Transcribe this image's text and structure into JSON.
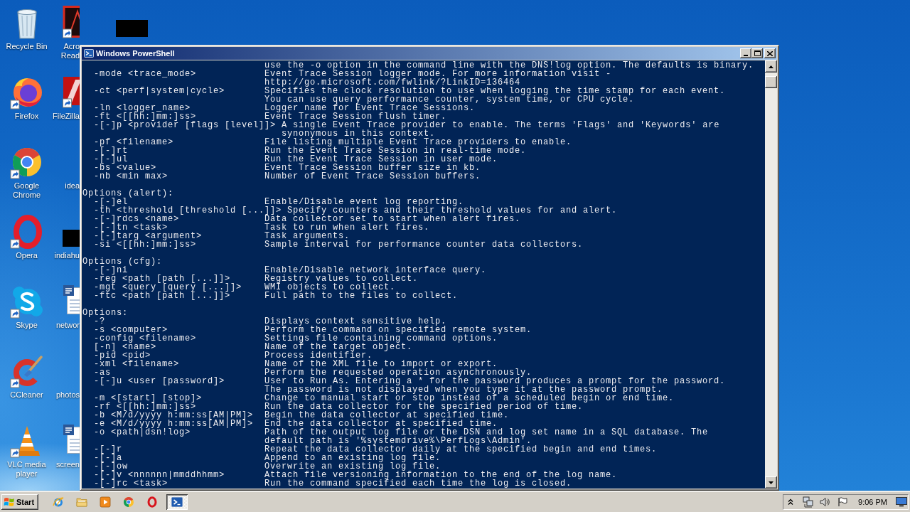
{
  "desktop": {
    "columns": [
      {
        "icons": [
          {
            "label": "Recycle Bin"
          },
          {
            "label": "Firefox"
          },
          {
            "label": "Google Chrome"
          },
          {
            "label": "Opera"
          },
          {
            "label": "Skype"
          },
          {
            "label": "CCleaner"
          },
          {
            "label": "VLC media player"
          }
        ]
      },
      {
        "icons": [
          {
            "label": "Acro Read"
          },
          {
            "label": "FileZilla"
          },
          {
            "label": "idea"
          },
          {
            "label": "indiahu"
          },
          {
            "label": "networ"
          },
          {
            "label": "photos"
          },
          {
            "label": "screen"
          }
        ]
      }
    ]
  },
  "window": {
    "title": "Windows PowerShell",
    "console": {
      "sections": [
        {
          "entries": [
            {
              "description": [
                "use the -o option in the command line with the DNS!log option. The defaults is binary."
              ]
            },
            {
              "option": "-mode <trace_mode>",
              "description": [
                "Event Trace Session logger mode. For more information visit -",
                "http://go.microsoft.com/fwlink/?LinkID=136464"
              ]
            },
            {
              "option": "-ct <perf|system|cycle>",
              "description": [
                "Specifies the clock resolution to use when logging the time stamp for each event.",
                "You can use query performance counter, system time, or CPU cycle."
              ]
            },
            {
              "option": "-ln <logger_name>",
              "description": [
                "Logger name for Event Trace Sessions."
              ]
            },
            {
              "option": "-ft <[[hh:]mm:]ss>",
              "description": [
                "Event Trace Session flush timer."
              ]
            },
            {
              "option": "-[-]p <provider [flags [level]]>",
              "description": [
                "A single Event Trace provider to enable. The terms 'Flags' and 'Keywords' are",
                "synonymous in this context."
              ]
            },
            {
              "option": "-pf <filename>",
              "description": [
                "File listing multiple Event Trace providers to enable."
              ]
            },
            {
              "option": "-[-]rt",
              "description": [
                "Run the Event Trace Session in real-time mode."
              ]
            },
            {
              "option": "-[-]ul",
              "description": [
                "Run the Event Trace Session in user mode."
              ]
            },
            {
              "option": "-bs <value>",
              "description": [
                "Event Trace Session buffer size in kb."
              ]
            },
            {
              "option": "-nb <min max>",
              "description": [
                "Number of Event Trace Session buffers."
              ]
            }
          ]
        },
        {
          "heading": "Options (alert):",
          "entries": [
            {
              "option": "-[-]el",
              "description": [
                "Enable/Disable event log reporting."
              ]
            },
            {
              "option": "-th <threshold [threshold [...]]>",
              "description": [
                "Specify counters and their threshold values for and alert."
              ]
            },
            {
              "option": "-[-]rdcs <name>",
              "description": [
                "Data collector set to start when alert fires."
              ]
            },
            {
              "option": "-[-]tn <task>",
              "description": [
                "Task to run when alert fires."
              ]
            },
            {
              "option": "-[-]targ <argument>",
              "description": [
                "Task arguments."
              ]
            },
            {
              "option": "-si <[[hh:]mm:]ss>",
              "description": [
                "Sample interval for performance counter data collectors."
              ]
            }
          ]
        },
        {
          "heading": "Options (cfg):",
          "entries": [
            {
              "option": "-[-]ni",
              "description": [
                "Enable/Disable network interface query."
              ]
            },
            {
              "option": "-reg <path [path [...]]>",
              "description": [
                "Registry values to collect."
              ]
            },
            {
              "option": "-mgt <query [query [...]]>",
              "description": [
                "WMI objects to collect."
              ]
            },
            {
              "option": "-ftc <path [path [...]]>",
              "description": [
                "Full path to the files to collect."
              ]
            }
          ]
        },
        {
          "heading": "Options:",
          "entries": [
            {
              "option": "-?",
              "description": [
                "Displays context sensitive help."
              ]
            },
            {
              "option": "-s <computer>",
              "description": [
                "Perform the command on specified remote system."
              ]
            },
            {
              "option": "-config <filename>",
              "description": [
                "Settings file containing command options."
              ]
            },
            {
              "option": "[-n] <name>",
              "description": [
                "Name of the target object."
              ]
            },
            {
              "option": "-pid <pid>",
              "description": [
                "Process identifier."
              ]
            },
            {
              "option": "-xml <filename>",
              "description": [
                "Name of the XML file to import or export."
              ]
            },
            {
              "option": "-as",
              "description": [
                "Perform the requested operation asynchronously."
              ]
            },
            {
              "option": "-[-]u <user [password]>",
              "description": [
                "User to Run As. Entering a * for the password produces a prompt for the password.",
                "The password is not displayed when you type it at the password prompt."
              ]
            },
            {
              "option": "-m <[start] [stop]>",
              "description": [
                "Change to manual start or stop instead of a scheduled begin or end time."
              ]
            },
            {
              "option": "-rf <[[hh:]mm:]ss>",
              "description": [
                "Run the data collector for the specified period of time."
              ]
            },
            {
              "option": "-b <M/d/yyyy h:mm:ss[AM|PM]>",
              "description": [
                "Begin the data collector at specified time."
              ]
            },
            {
              "option": "-e <M/d/yyyy h:mm:ss[AM|PM]>",
              "description": [
                "End the data collector at specified time."
              ]
            },
            {
              "option": "-o <path|dsn!log>",
              "description": [
                "Path of the output log file or the DSN and log set name in a SQL database. The",
                "default path is '%systemdrive%\\PerfLogs\\Admin'."
              ]
            },
            {
              "option": "-[-]r",
              "description": [
                "Repeat the data collector daily at the specified begin and end times."
              ]
            },
            {
              "option": "-[-]a",
              "description": [
                "Append to an existing log file."
              ]
            },
            {
              "option": "-[-]ow",
              "description": [
                "Overwrite an existing log file."
              ]
            },
            {
              "option": "-[-]v <nnnnnn|mmddhhmm>",
              "description": [
                "Attach file versioning information to the end of the log name."
              ]
            },
            {
              "option": "-[-]rc <task>",
              "description": [
                "Run the command specified each time the log is closed."
              ]
            }
          ]
        }
      ]
    }
  },
  "taskbar": {
    "start_label": "Start",
    "tasks": [
      {
        "selected": true
      }
    ],
    "clock": "9:06 PM"
  }
}
